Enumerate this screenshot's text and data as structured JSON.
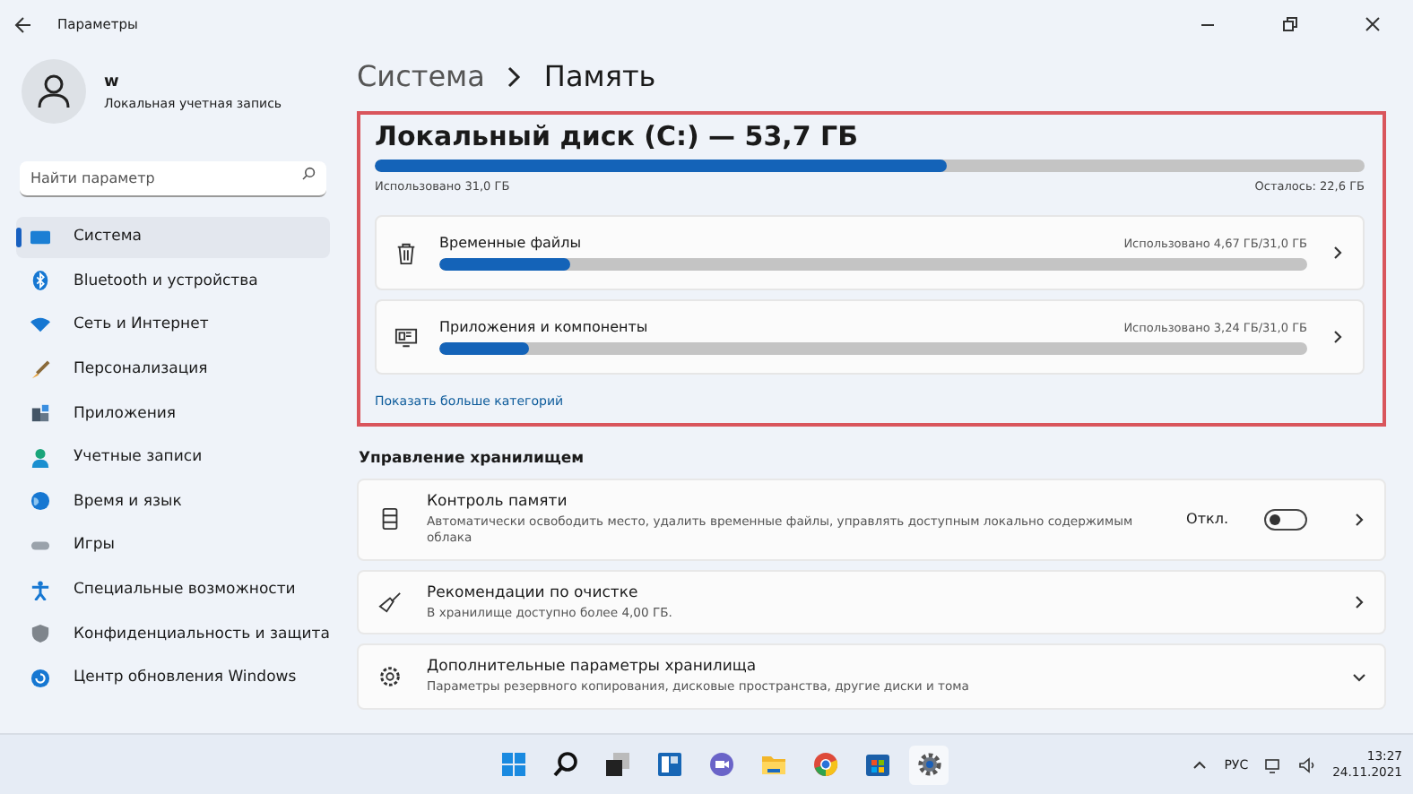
{
  "window": {
    "title": "Параметры"
  },
  "user": {
    "name": "w",
    "account_type": "Локальная учетная запись"
  },
  "search": {
    "placeholder": "Найти параметр"
  },
  "sidebar": {
    "items": [
      {
        "label": "Система",
        "kind": "system",
        "selected": true
      },
      {
        "label": "Bluetooth и устройства",
        "kind": "bluetooth",
        "selected": false
      },
      {
        "label": "Сеть и Интернет",
        "kind": "network",
        "selected": false
      },
      {
        "label": "Персонализация",
        "kind": "brush",
        "selected": false
      },
      {
        "label": "Приложения",
        "kind": "apps",
        "selected": false
      },
      {
        "label": "Учетные записи",
        "kind": "person",
        "selected": false
      },
      {
        "label": "Время и язык",
        "kind": "globe",
        "selected": false
      },
      {
        "label": "Игры",
        "kind": "gamepad",
        "selected": false
      },
      {
        "label": "Специальные возможности",
        "kind": "access",
        "selected": false
      },
      {
        "label": "Конфиденциальность и защита",
        "kind": "shield",
        "selected": false
      },
      {
        "label": "Центр обновления Windows",
        "kind": "update",
        "selected": false
      }
    ]
  },
  "breadcrumb": [
    "Система",
    "Память"
  ],
  "disk": {
    "title": "Локальный диск (C:) — 53,7 ГБ",
    "level": 0.577,
    "used": "Использовано 31,0 ГБ",
    "free": "Осталось: 22,6 ГБ",
    "categories": [
      {
        "kind": "trash",
        "name": "Временные файлы",
        "usage": "Использовано 4,67 ГБ/31,0 ГБ",
        "level": 0.15
      },
      {
        "kind": "apps",
        "name": "Приложения и компоненты",
        "usage": "Использовано 3,24 ГБ/31,0 ГБ",
        "level": 0.104
      }
    ],
    "show_more": "Показать больше категорий"
  },
  "storage_management": {
    "heading": "Управление хранилищем",
    "items": [
      {
        "kind": "toggle",
        "title": "Контроль памяти",
        "description": "Автоматически освободить место, удалить временные файлы, управлять доступным локально содержимым облака",
        "toggle_label": "Откл.",
        "on": false
      },
      {
        "kind": "link",
        "title": "Рекомендации по очистке",
        "description": "В хранилище доступно более 4,00 ГБ."
      },
      {
        "kind": "expand",
        "title": "Дополнительные параметры хранилища",
        "description": "Параметры резервного копирования, дисковые пространства, другие диски и тома"
      }
    ]
  },
  "taskbar": {
    "language": "РУС",
    "time": "13:27",
    "date": "24.11.2021"
  }
}
